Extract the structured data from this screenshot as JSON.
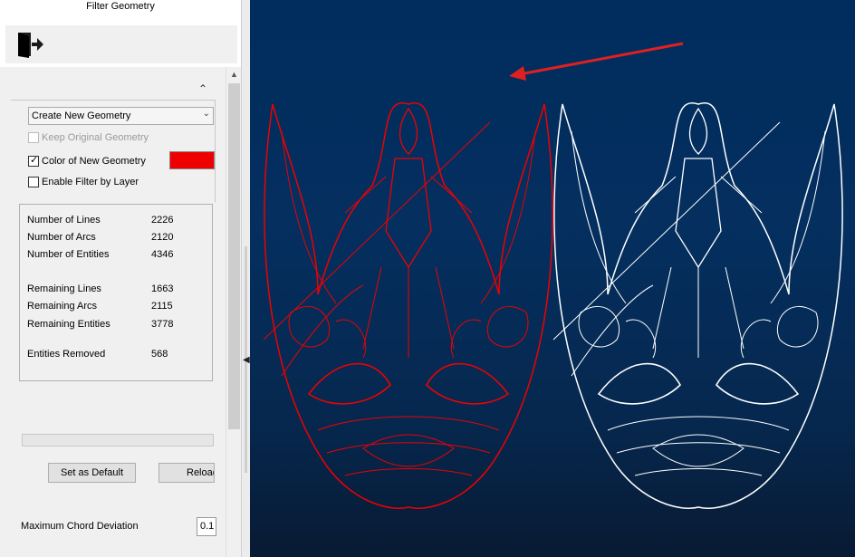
{
  "window": {
    "title": "Filter Geometry"
  },
  "toolbar": {
    "exit_icon": "exit-door-icon"
  },
  "options": {
    "mode_select": "Create New Geometry",
    "keep_original_label": "Keep Original Geometry",
    "keep_original_checked": false,
    "color_label": "Color of New Geometry",
    "color_checked": true,
    "new_geometry_color": "#ee0000",
    "filter_layer_label": "Enable Filter by Layer",
    "filter_layer_checked": false
  },
  "stats": {
    "rows": [
      {
        "label": "Number of Lines",
        "value": "2226"
      },
      {
        "label": "Number of Arcs",
        "value": "2120"
      },
      {
        "label": "Number of Entities",
        "value": "4346"
      },
      {
        "label": "Remaining Lines",
        "value": "1663"
      },
      {
        "label": "Remaining Arcs",
        "value": "2115"
      },
      {
        "label": "Remaining Entities",
        "value": "3778"
      },
      {
        "label": "Entities Removed",
        "value": "568"
      }
    ]
  },
  "buttons": {
    "set_default": "Set as Default",
    "reload": "Reload"
  },
  "chord": {
    "label": "Maximum Chord Deviation",
    "value": "0.1"
  },
  "canvas": {
    "background": "#002d5e",
    "filtered_color": "#ee0000",
    "original_color": "#ffffff",
    "annotation_color": "#e02020"
  }
}
